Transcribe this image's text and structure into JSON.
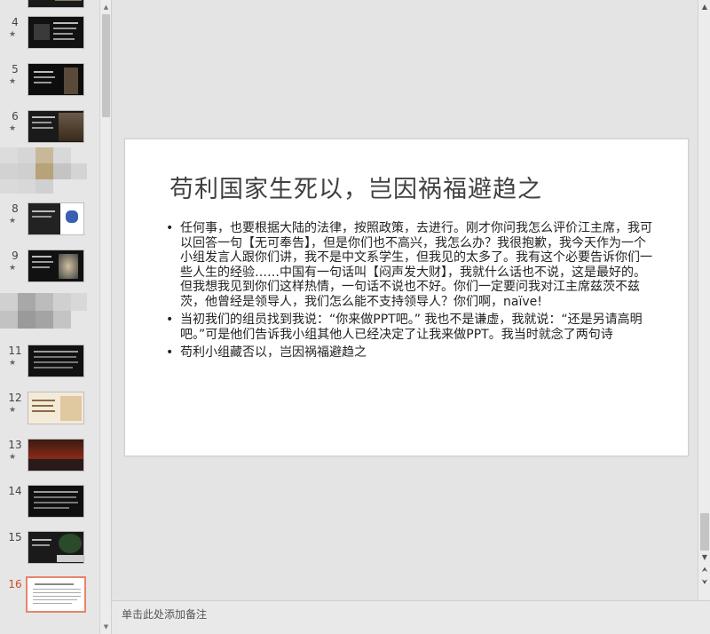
{
  "thumbnails": [
    {
      "num": "4",
      "star": "★",
      "colors": [
        "#111111",
        "#3a3a3a",
        "#bfb39a"
      ]
    },
    {
      "num": "5",
      "star": "★",
      "colors": [
        "#0d0d0d",
        "#2e2e2e",
        "#c0a070"
      ]
    },
    {
      "num": "6",
      "star": "★",
      "colors": [
        "#1a1a1a",
        "#5a4a3a",
        "#8a6a4a"
      ]
    },
    {
      "num": "8",
      "star": "★",
      "colors": [
        "#222222",
        "#ffffff",
        "#3a5fb0"
      ]
    },
    {
      "num": "9",
      "star": "★",
      "colors": [
        "#111111",
        "#444444",
        "#d0c0a0"
      ]
    },
    {
      "num": "11",
      "star": "★",
      "colors": [
        "#111111",
        "#333333",
        "#888888"
      ]
    },
    {
      "num": "12",
      "star": "★",
      "colors": [
        "#f4ead8",
        "#c8a878",
        "#6a4a2a"
      ]
    },
    {
      "num": "13",
      "star": "★",
      "colors": [
        "#1a1010",
        "#8a2a1a",
        "#c04020"
      ]
    },
    {
      "num": "14",
      "star": "",
      "colors": [
        "#101010",
        "#3a3a3a",
        "#6a6a6a"
      ]
    },
    {
      "num": "15",
      "star": "",
      "colors": [
        "#1a1a1a",
        "#2a4a2a",
        "#d0d0d0"
      ]
    },
    {
      "num": "16",
      "star": "",
      "colors": [
        "#ffffff",
        "#dddddd",
        "#aaaaaa"
      ]
    }
  ],
  "slide": {
    "title": "苟利国家生死以，岂因祸福避趋之",
    "bullets": [
      "任何事，也要根据大陆的法律，按照政策，去进行。刚才你问我怎么评价江主席，我可以回答一句【无可奉告】，但是你们也不高兴，我怎么办？我很抱歉，我今天作为一个小组发言人跟你们讲，我不是中文系学生，但我见的太多了。我有这个必要告诉你们一些人生的经验……中国有一句话叫【闷声发大财】，我就什么话也不说，这是最好的。但我想我见到你们这样热情，一句话不说也不好。你们一定要问我对江主席兹茨不兹茨，他曾经是领导人，我们怎么能不支持领导人？你们啊，naïve!",
      "当初我们的组员找到我说：“你来做PPT吧。” 我也不是谦虚，我就说：“还是另请高明吧。”可是他们告诉我小组其他人已经决定了让我来做PPT。我当时就念了两句诗",
      "苟利小组藏否以，岂因祸福避趋之"
    ],
    "bullet_char": "•"
  },
  "notes": {
    "placeholder": "单击此处添加备注"
  },
  "scroll": {
    "up": "▲",
    "down": "▼",
    "prev": "⮝",
    "next": "⮟"
  }
}
